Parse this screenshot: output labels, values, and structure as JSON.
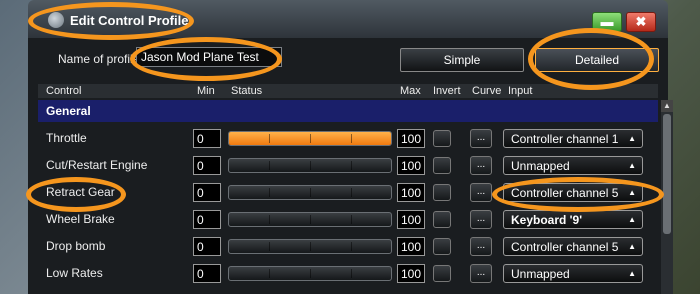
{
  "window": {
    "title": "Edit Control Profile",
    "minimize_glyph": "▬",
    "close_glyph": "✖"
  },
  "profile": {
    "name_label": "Name of profile",
    "name_value": "Jason Mod Plane Test"
  },
  "modes": {
    "simple": "Simple",
    "detailed": "Detailed",
    "selected": "Detailed"
  },
  "columns": {
    "control": "Control",
    "min": "Min",
    "status": "Status",
    "max": "Max",
    "invert": "Invert",
    "curve": "Curve",
    "input": "Input"
  },
  "group": "General",
  "rows": [
    {
      "control": "Throttle",
      "min": "0",
      "max": "100",
      "status_fill": 1.0,
      "input": "Controller channel 1",
      "input_bold": false
    },
    {
      "control": "Cut/Restart Engine",
      "min": "0",
      "max": "100",
      "status_fill": 0.0,
      "input": "Unmapped",
      "input_bold": false
    },
    {
      "control": "Retract Gear",
      "min": "0",
      "max": "100",
      "status_fill": 0.0,
      "input": "Controller channel 5",
      "input_bold": false
    },
    {
      "control": "Wheel Brake",
      "min": "0",
      "max": "100",
      "status_fill": 0.0,
      "input": "Keyboard '9'",
      "input_bold": true
    },
    {
      "control": "Drop bomb",
      "min": "0",
      "max": "100",
      "status_fill": 0.0,
      "input": "Controller channel 5",
      "input_bold": false
    },
    {
      "control": "Low Rates",
      "min": "0",
      "max": "100",
      "status_fill": 0.0,
      "input": "Unmapped",
      "input_bold": false
    }
  ],
  "curve_label": "...",
  "colors": {
    "highlight": "#f5961e",
    "status_fill": "#f07a10",
    "group_bg": "#1a1f6a"
  }
}
